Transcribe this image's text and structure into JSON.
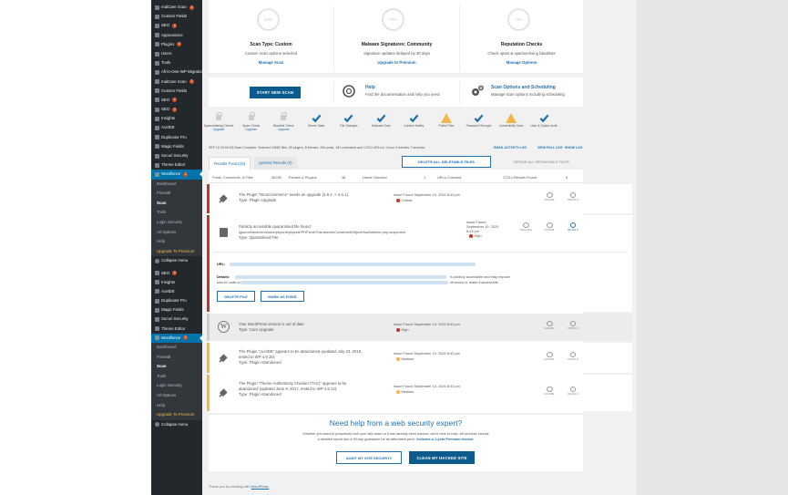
{
  "sidebar": {
    "items": [
      {
        "label": "malCare Scan",
        "badge": "1",
        "icon": "shield-icon"
      },
      {
        "label": "Custom Fields",
        "icon": "list-icon"
      },
      {
        "label": "SEO",
        "badge": "2",
        "icon": "seo-icon"
      },
      {
        "label": "Appearance",
        "icon": "brush-icon"
      },
      {
        "label": "Plugins",
        "badge": "3",
        "icon": "plug-icon"
      },
      {
        "label": "Users",
        "icon": "user-icon"
      },
      {
        "label": "Tools",
        "icon": "wrench-icon"
      },
      {
        "label": "All-in-One WP Migration",
        "icon": "migration-icon"
      },
      {
        "label": "malCare Scan",
        "badge": "1",
        "icon": "shield-icon"
      },
      {
        "label": "Custom Fields",
        "icon": "list-icon"
      },
      {
        "label": "SEO",
        "badge": "2",
        "icon": "seo-icon"
      },
      {
        "label": "SEO",
        "badge": "2",
        "icon": "seo-icon"
      },
      {
        "label": "Insights",
        "icon": "insights-icon"
      },
      {
        "label": "AcelDE",
        "icon": "editor-icon"
      },
      {
        "label": "Duplicator Pro",
        "icon": "duplicator-icon"
      },
      {
        "label": "Magic Fields",
        "icon": "magic-icon"
      },
      {
        "label": "Sucuri Security",
        "icon": "sucuri-icon"
      },
      {
        "label": "Theme Editor",
        "icon": "theme-icon"
      },
      {
        "label": "Wordfence",
        "badge": "2",
        "icon": "wordfence-icon"
      }
    ],
    "wordfence_sub": [
      "Dashboard",
      "Firewall",
      "Scan",
      "Tools",
      "Login Security",
      "All Options",
      "Help",
      "Upgrade To Premium"
    ],
    "collapse": "Collapse menu",
    "items2": [
      {
        "label": "SEO",
        "badge": "2",
        "icon": "seo-icon"
      },
      {
        "label": "Insights",
        "icon": "insights-icon"
      },
      {
        "label": "AcelDE",
        "icon": "editor-icon"
      },
      {
        "label": "Duplicator Pro",
        "icon": "duplicator-icon"
      },
      {
        "label": "Magic Fields",
        "icon": "magic-icon"
      },
      {
        "label": "Sucuri Security",
        "icon": "sucuri-icon"
      },
      {
        "label": "Theme Editor",
        "icon": "theme-icon"
      },
      {
        "label": "Wordfence",
        "badge": "2",
        "icon": "wordfence-icon"
      }
    ],
    "wordfence_sub2": [
      "Dashboard",
      "Firewall",
      "Scan",
      "Tools",
      "Login Security",
      "All Options",
      "Help",
      "Upgrade To Premium"
    ],
    "collapse2": "Collapse menu"
  },
  "summary": {
    "col1": {
      "percent": "60%",
      "title": "Scan Type: Custom",
      "desc": "Custom scan options selected",
      "link": "Manage Scan"
    },
    "col2": {
      "percent": "70%",
      "title": "Malware Signatures: Community",
      "desc": "Signature updates delayed by 30 days",
      "link": "Upgrade to Premium"
    },
    "col3": {
      "percent": "0%",
      "title": "Reputation Checks",
      "desc": "Check spam & spamvertising blacklists",
      "link": "Manage Options"
    }
  },
  "actions": {
    "start_scan": "START NEW SCAN",
    "help_title": "Help",
    "help_desc": "Find the documentation and help you need",
    "options_title": "Scan Options and Scheduling",
    "options_desc": "Manage scan options including scheduling"
  },
  "stages": [
    {
      "label": "Spamvertising Checks",
      "sub": "Upgrade",
      "state": "locked"
    },
    {
      "label": "Spam Check",
      "sub": "Upgrade",
      "state": "locked"
    },
    {
      "label": "Blacklist Check",
      "sub": "Upgrade",
      "state": "locked"
    },
    {
      "label": "Server State",
      "state": "ok"
    },
    {
      "label": "File Changes",
      "state": "ok"
    },
    {
      "label": "Malware Scan",
      "state": "ok"
    },
    {
      "label": "Content Safety",
      "state": "ok"
    },
    {
      "label": "Public Files",
      "state": "warn"
    },
    {
      "label": "Password Strength",
      "state": "ok"
    },
    {
      "label": "Vulnerability Scan",
      "state": "warn"
    },
    {
      "label": "User & Option Audit",
      "state": "ok"
    }
  ],
  "status_line": "SEP 10 20:45:42] Scan Complete. Scanned 29682 files, 35 plugins, 8 themes, 496 posts, 181 comments and 17214 URLs in 1 hour 3 minutes 7 seconds.",
  "log_links": {
    "email": "EMAIL ACTIVITY LOG",
    "view": "VIEW FULL LOG",
    "show": "SHOW LOG"
  },
  "tabs": {
    "results": "Results Found (5)",
    "ignored": "Ignored Results (0)"
  },
  "buttons": {
    "delete_all": "DELETE ALL DELETABLE FILES",
    "repair_all": "REPAIR ALL REPAIRABLE FILES"
  },
  "stats": [
    {
      "label": "Posts, Comments, & Files",
      "value": "30239"
    },
    {
      "label": "Themes & Plugins",
      "value": "38"
    },
    {
      "label": "Users Checked",
      "value": "1"
    },
    {
      "label": "URLs Checked",
      "value": "17214"
    },
    {
      "label": "Results Found",
      "value": "5"
    }
  ],
  "issues": [
    {
      "title": "The Plugin \"WooCommerce\" needs an upgrade (3.9.1 -> 4.5.1).",
      "type": "Type: Plugin Upgrade",
      "found": "Issue Found September 10, 2020 8:43 pm",
      "severity": "Critical",
      "sev_color": "#c0392b"
    },
    {
      "title": "Publicly accessible quarantined file found:",
      "path": "/gscro/brainiree/vendor/phpunit/phpunit/PHPUnit/Framework/Constraint/ObjectHasAttribute.php.suspected",
      "type": "Type: Quarantined File",
      "found_l1": "Issue Found",
      "found_l2": "September 10, 2020",
      "found_l3": "8:43 pm",
      "severity": "High",
      "sev_color": "#c0392b"
    },
    {
      "title": "Your WordPress version is out of date",
      "type": "Type: Core Upgrade",
      "found": "Issue Found September 10, 2020 8:43 pm",
      "severity": "High",
      "sev_color": "#c0392b"
    },
    {
      "title": "The Plugin \"AcelDE\" appears to be abandoned (updated July 23, 2018,",
      "title2": "tested to WP 4.9.15).",
      "type": "Type: Plugin Abandoned",
      "found": "Issue Found September 10, 2020 8:43 pm",
      "severity": "Medium",
      "sev_color": "#f0b849"
    },
    {
      "title": "The Plugin \"Theme Authenticity Checker (TAC)\" appears to be",
      "title2": "abandoned (updated June 9, 2017, tested to WP 4.8.14).",
      "type": "Type: Plugin Abandoned",
      "found": "Issue Found September 10, 2020 8:43 pm",
      "severity": "Medium",
      "sev_color": "#f0b849"
    }
  ],
  "issue_actions": {
    "ignore": "IGNORE",
    "details": "DETAILS",
    "view_file": "VIEW FILE"
  },
  "detail": {
    "url_label": "URL:",
    "details_label": "Details:",
    "details_text": "is publicly accessible and may expose",
    "details_text2": "source code or",
    "details_text3": "removed or made inaccessible.",
    "delete_file": "DELETE FILE",
    "mark_fixed": "MARK AS FIXED"
  },
  "promo": {
    "title": "Need help from a web security expert?",
    "body1": "Whether you want to proactively lock your site down or it has already been hacked, we're here to help. All services include",
    "body2": "a detailed report and a 90-day guarantee for an affordable price.",
    "body2_link": "Includes a 1-year Premium license.",
    "audit": "AUDIT MY SITE SECURITY",
    "clean": "CLEAN MY HACKED SITE"
  },
  "footer": {
    "text": "Thank you for creating with",
    "link": "WordPress."
  },
  "colors": {
    "primary": "#0b5b8f",
    "link": "#2271b1",
    "ok": "#1b6fa8",
    "warn": "#f0b849",
    "critical": "#c0392b",
    "sidebar": "#23282d",
    "active_menu": "#0073aa"
  }
}
